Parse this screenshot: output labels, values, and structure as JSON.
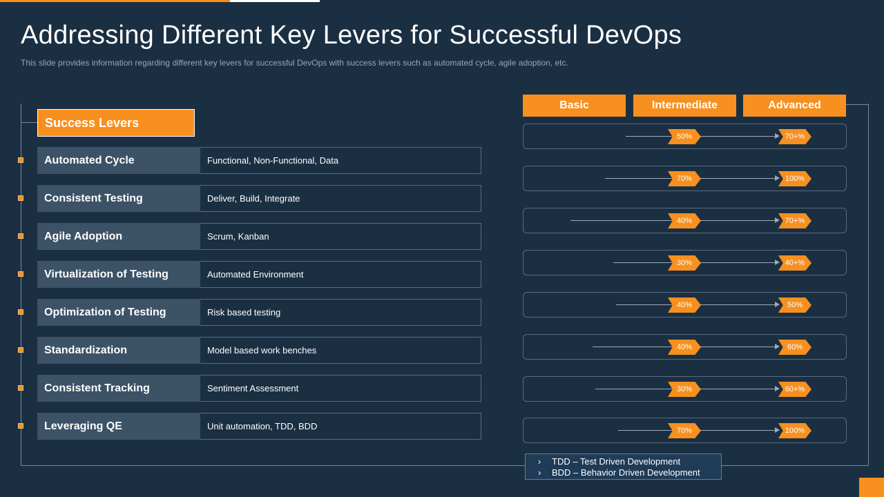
{
  "slide": {
    "title": "Addressing  Different Key Levers for Successful DevOps",
    "subtitle": "This slide provides  information  regarding  different  key levers  for successful DevOps  with success levers  such as automated cycle, agile adoption,  etc."
  },
  "levers_header": "Success Levers",
  "levers": [
    {
      "name": "Automated Cycle",
      "desc": "Functional, Non-Functional,  Data"
    },
    {
      "name": "Consistent Testing",
      "desc": "Deliver,  Build, Integrate"
    },
    {
      "name": "Agile Adoption",
      "desc": "Scrum, Kanban"
    },
    {
      "name": "Virtualization of Testing",
      "desc": "Automated Environment"
    },
    {
      "name": "Optimization of Testing",
      "desc": "Risk based testing"
    },
    {
      "name": "Standardization",
      "desc": "Model based work benches"
    },
    {
      "name": "Consistent Tracking",
      "desc": "Sentiment Assessment"
    },
    {
      "name": "Leveraging QE",
      "desc": "Unit automation, TDD,  BDD"
    }
  ],
  "levels": [
    "Basic",
    "Intermediate",
    "Advanced"
  ],
  "progress": [
    {
      "current": "50%",
      "target": "70+%"
    },
    {
      "current": "70%",
      "target": "100%"
    },
    {
      "current": "40%",
      "target": "70+%"
    },
    {
      "current": "30%",
      "target": "40+%"
    },
    {
      "current": "40%",
      "target": "50%"
    },
    {
      "current": "40%",
      "target": "60%"
    },
    {
      "current": "30%",
      "target": "60+%"
    },
    {
      "current": "70%",
      "target": "100%"
    }
  ],
  "legend": [
    {
      "chevron": "›",
      "text": "TDD – Test Driven  Development"
    },
    {
      "chevron": "›",
      "text": "BDD – Behavior  Driven  Development"
    }
  ],
  "colors": {
    "background": "#1b2f43",
    "accent": "#f7901e",
    "lever_name_bg": "#3c5266"
  }
}
